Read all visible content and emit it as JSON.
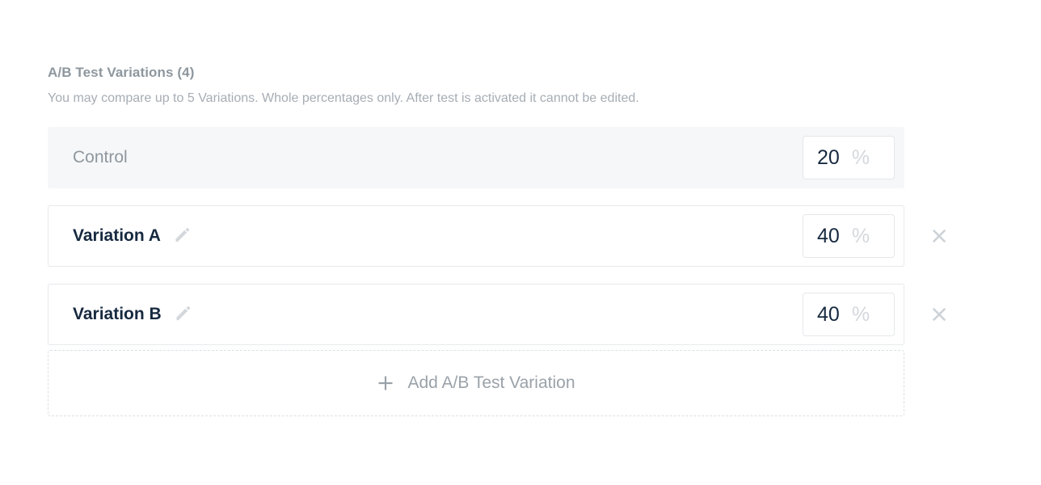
{
  "section": {
    "title": "A/B Test Variations (4)",
    "description": "You may compare up to 5 Variations. Whole percentages only. After test is activated it cannot be edited."
  },
  "colors": {
    "title_text": "#8e979e",
    "description_text": "#a6adb4",
    "control_row_bg": "#f6f7f9",
    "variation_label": "#16293f",
    "input_border": "#e4e7ea",
    "percent_sign": "#d3d8dd",
    "icon_gray": "#ccd2d7",
    "dashed_border": "#dcdfe3"
  },
  "rows": [
    {
      "label": "Control",
      "percent": "20",
      "percent_sign": "%",
      "editable": false,
      "removable": false
    },
    {
      "label": "Variation A",
      "percent": "40",
      "percent_sign": "%",
      "editable": true,
      "removable": true,
      "edit_icon": "pencil-icon",
      "remove_icon": "close-icon"
    },
    {
      "label": "Variation B",
      "percent": "40",
      "percent_sign": "%",
      "editable": true,
      "removable": true,
      "edit_icon": "pencil-icon",
      "remove_icon": "close-icon"
    }
  ],
  "add_button": {
    "label": "Add A/B Test Variation",
    "icon": "plus-icon"
  }
}
